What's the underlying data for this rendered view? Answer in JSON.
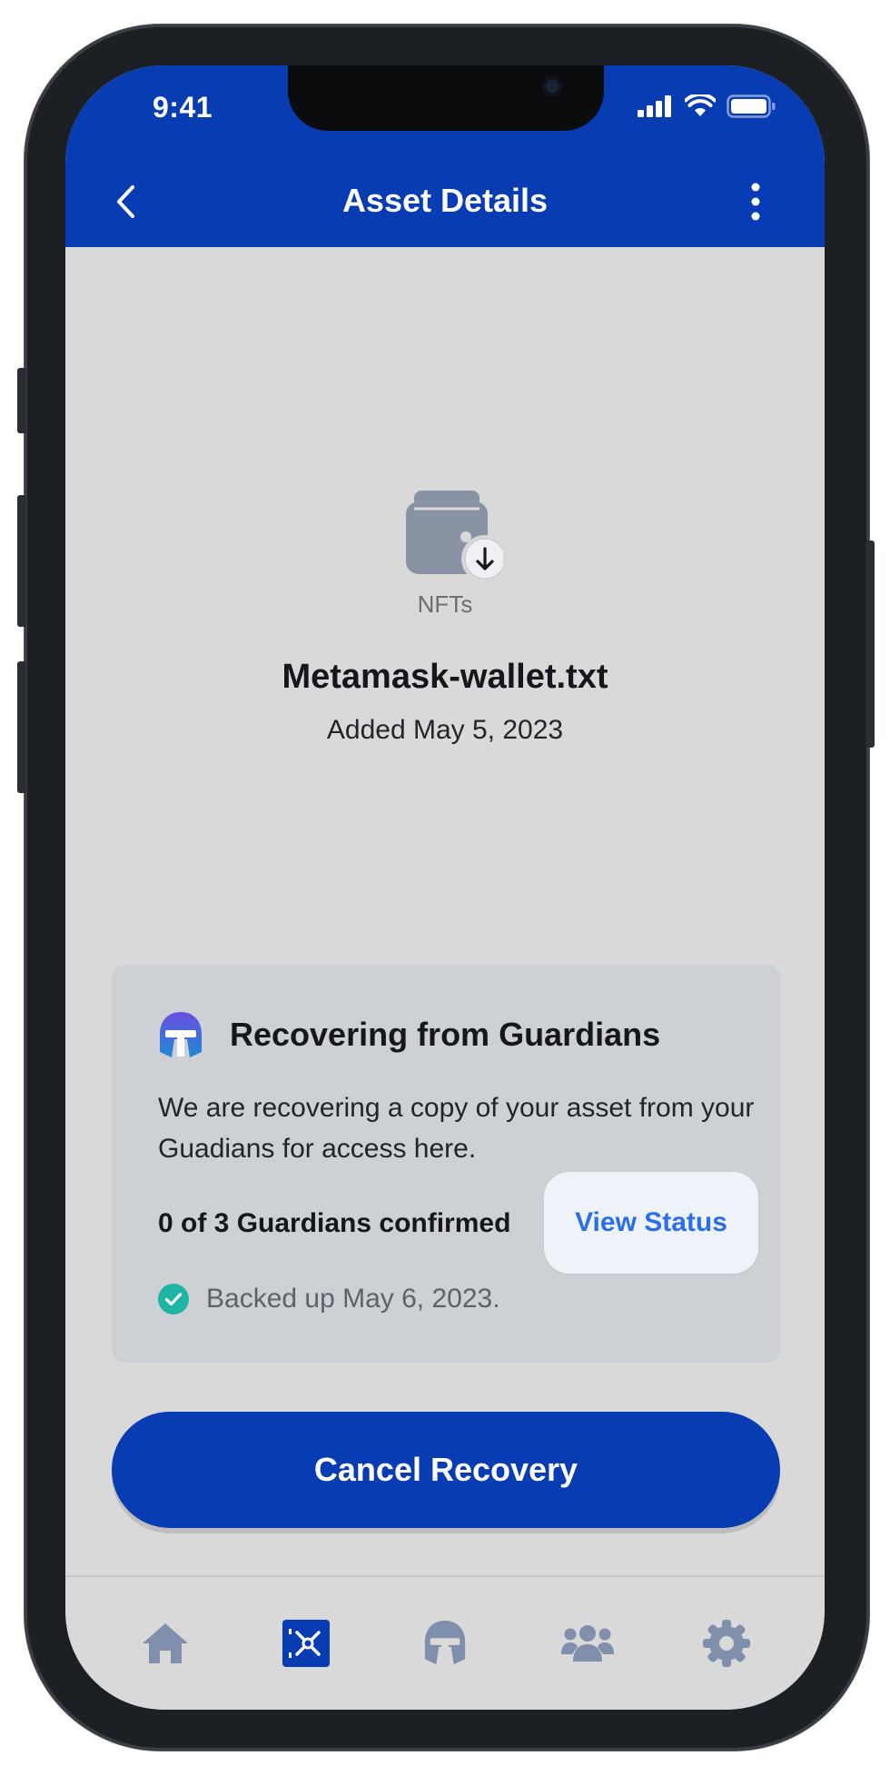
{
  "status_bar": {
    "time": "9:41"
  },
  "header": {
    "title": "Asset Details"
  },
  "asset": {
    "category": "NFTs",
    "name": "Metamask-wallet.txt",
    "added": "Added May 5, 2023"
  },
  "recovery_card": {
    "title": "Recovering from Guardians",
    "description": "We are recovering a copy of your asset from your Guadians for access here.",
    "guardians_confirmed": "0 of 3 Guardians confirmed",
    "view_status_label": "View Status",
    "backed_up": "Backed up May 6, 2023."
  },
  "actions": {
    "cancel_label": "Cancel Recovery"
  },
  "bottom_nav": {
    "items": [
      {
        "icon": "home-icon",
        "active": false
      },
      {
        "icon": "vault-icon",
        "active": true
      },
      {
        "icon": "guardian-helmet-icon",
        "active": false
      },
      {
        "icon": "people-icon",
        "active": false
      },
      {
        "icon": "settings-icon",
        "active": false
      }
    ]
  },
  "colors": {
    "primary": "#073CB2",
    "background": "#D9D9D9",
    "card": "#CDD0D5",
    "link": "#2B6EE6",
    "success": "#1FB5A5",
    "nav_icon": "#8090AC"
  }
}
